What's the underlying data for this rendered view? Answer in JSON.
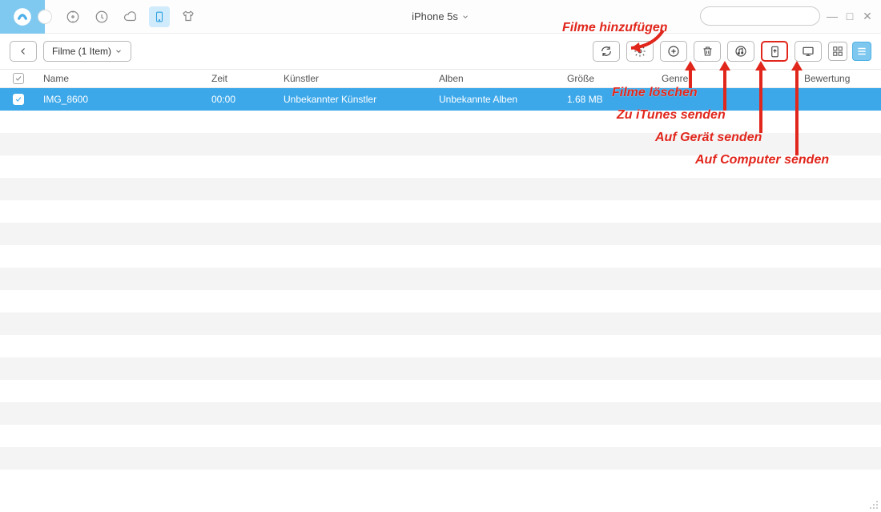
{
  "device_name": "iPhone 5s",
  "filter": {
    "label": "Filme (1 Item)"
  },
  "columns": {
    "name": "Name",
    "time": "Zeit",
    "artist": "Künstler",
    "album": "Alben",
    "size": "Größe",
    "genre": "Genre",
    "rating": "Bewertung"
  },
  "rows": [
    {
      "name": "IMG_8600",
      "time": "00:00",
      "artist": "Unbekannter Künstler",
      "album": "Unbekannte Alben",
      "size": "1.68 MB",
      "genre": "",
      "rating": ""
    }
  ],
  "annotations": {
    "add": "Filme hinzufügen",
    "delete": "Filme löschen",
    "to_itunes": "Zu iTunes senden",
    "to_device": "Auf Gerät senden",
    "to_computer": "Auf Computer senden"
  },
  "search_placeholder": ""
}
